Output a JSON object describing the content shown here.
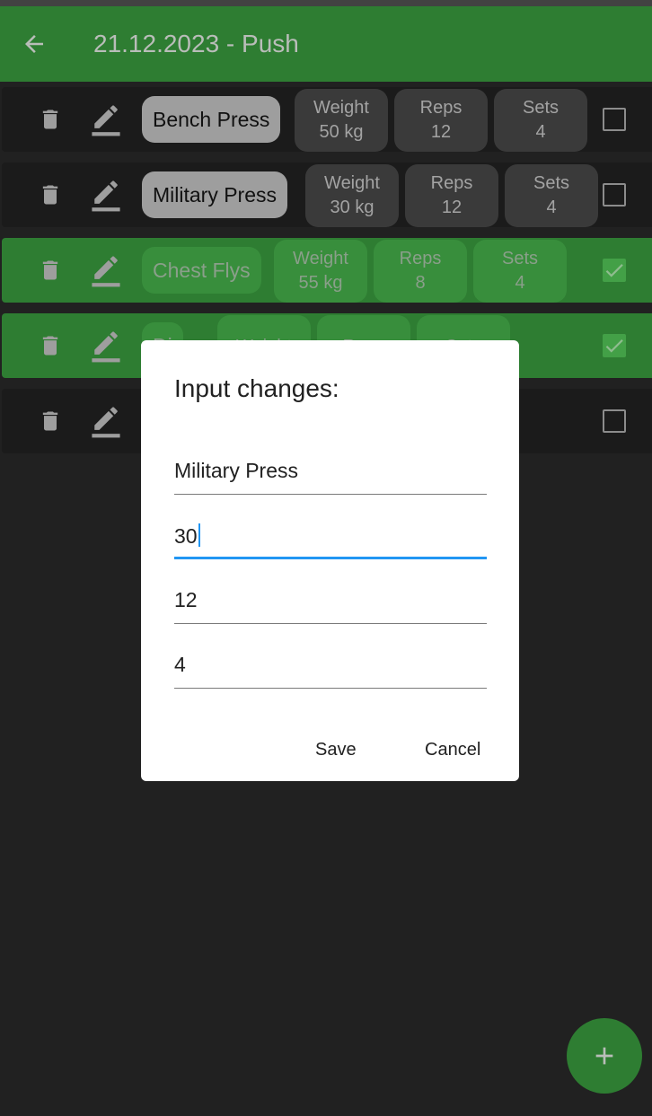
{
  "appbar": {
    "title": "21.12.2023 - Push",
    "back_icon": "arrow-left-icon"
  },
  "exercises": [
    {
      "name": "Bench Press",
      "weight_label": "Weight",
      "weight": "50 kg",
      "reps_label": "Reps",
      "reps": "12",
      "sets_label": "Sets",
      "sets": "4",
      "done": false
    },
    {
      "name": "Military Press",
      "weight_label": "Weight",
      "weight": "30 kg",
      "reps_label": "Reps",
      "reps": "12",
      "sets_label": "Sets",
      "sets": "4",
      "done": false
    },
    {
      "name": "Chest Flys",
      "weight_label": "Weight",
      "weight": "55 kg",
      "reps_label": "Reps",
      "reps": "8",
      "sets_label": "Sets",
      "sets": "4",
      "done": true
    },
    {
      "name": "Di",
      "weight_label": "Weight",
      "reps_label": "Reps",
      "sets_label": "Sets",
      "done": true
    },
    {
      "done": false
    }
  ],
  "dialog": {
    "title": "Input changes:",
    "fields": [
      "Military Press",
      "30",
      "12",
      "4"
    ],
    "save_label": "Save",
    "cancel_label": "Cancel"
  },
  "fab": {
    "icon": "plus-icon"
  },
  "colors": {
    "accent": "#2e7d32",
    "focus": "#2196f3",
    "background": "#212121"
  }
}
